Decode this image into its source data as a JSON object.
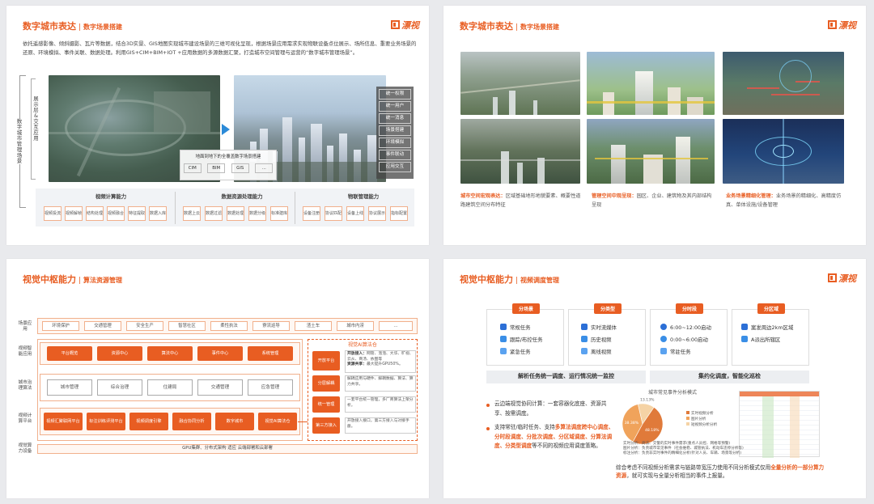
{
  "brand": {
    "logo": "漂视",
    "accent": "#e85d22"
  },
  "s1": {
    "title": "数字城市表达",
    "sub": "数字场景搭建",
    "para": "依托遥感影像、倾斜摄影、瓦片等数据，结合3D实景、GIS地图实现城市建设场景的三维可视化呈现，根据场景应用需求实现物联设备点位展示、场所信息、重要业务场景的还原、环境模拟、事件关联、数据处理。利用GIS+CIM+BIM+IOT +应用数据的多源数据汇聚，打造城市空间管理与运营的“数字城市管理场景”。",
    "side_outer": "数字城市管理场景",
    "side_inner": "展示层&交互应用",
    "menu": [
      "统一权限",
      "统一用户",
      "统一消息",
      "场景搭建",
      "环境模拟",
      "事件联动",
      "应用交互"
    ],
    "ground_title": "地面到地下的全覆盖数字场景搭建",
    "ground_items": [
      "CIM",
      "BIM",
      "GIS",
      "..."
    ],
    "groups": [
      {
        "title": "视频计算能力",
        "items": [
          "视频投流",
          "视频解帧",
          "结构处理",
          "视频融合",
          "特征提取",
          "数据入库"
        ]
      },
      {
        "title": "数据资源处理能力",
        "items": [
          "数据上云",
          "数据过滤",
          "数据处理",
          "数据分级",
          "标准建库"
        ]
      },
      {
        "title": "物联管理能力",
        "items": [
          "设备注册",
          "协议匹配",
          "设备上线",
          "协议展示",
          "指标配置"
        ]
      }
    ]
  },
  "s2": {
    "title": "数字城市表达",
    "sub": "数字场景搭建",
    "captions": [
      {
        "head": "城市空间宏观表达：",
        "body": "区域基础地形地貌要素、概要性道路建筑空间分布特征"
      },
      {
        "head": "管理空间中观呈现：",
        "body": "园区、企业、建筑物及其内部结构呈现"
      },
      {
        "head": "业务场景精细化管理：",
        "body": "业务场景的精细化、高精度仿真、单体设施/设备管理"
      }
    ]
  },
  "s3": {
    "title": "视觉中枢能力",
    "sub": "算法资源管理",
    "rows": [
      {
        "label": "场景应用",
        "items": [
          "环境保护",
          "交通管理",
          "安全生产",
          "智慧社区",
          "柔性执法",
          "寮流巡导",
          "渣土车",
          "城市内涝",
          "..."
        ]
      },
      {
        "label": "视频智能应用",
        "items": [
          "平台概览",
          "资源中心",
          "算法中心",
          "事件中心",
          "系统管理"
        ]
      },
      {
        "label": "城市治理算法",
        "items": [
          "城市管理",
          "综合治理",
          "住建局",
          "交通管理",
          "应急管理"
        ]
      },
      {
        "label": "视频计算平台",
        "items": [
          "视频汇聚联网平台",
          "标注训练评测平台",
          "视频调度引擎",
          "融合协同分析",
          "数字城市",
          "视觉AI算法仓"
        ]
      },
      {
        "label": "视觉算力设备",
        "items": [
          "GPU集群、分布式架构 适应 云端部署和云部署"
        ]
      }
    ],
    "ai_title": "视觉AI算法仓",
    "ai_items": [
      {
        "name": "开放平台",
        "head": "开放接入：",
        "text": "网管、泡泡、大华、旷视、云从、商汤、依图等",
        "head2": "资源共享：",
        "text2": "最大提升GPU50%。"
      },
      {
        "name": "分层解耦",
        "text": "解耦应用与硬件、解耦数据、算法、算力共享。"
      },
      {
        "name": "统一管理",
        "text": "一套平台统一管理，多厂商算法上架分析。"
      },
      {
        "name": "第三方接入",
        "text": "开放接入接口，第三方接入与对接手册。"
      }
    ]
  },
  "s4": {
    "title": "视觉中枢能力",
    "sub": "视频调度管理",
    "cols": [
      {
        "tag": "分场景",
        "items": [
          "常规任务",
          "跟踪/布控任务",
          "紧急任务"
        ]
      },
      {
        "tag": "分类型",
        "items": [
          "实时流媒体",
          "历史视频",
          "离线视频"
        ]
      },
      {
        "tag": "分时段",
        "items": [
          "6:00~12:00启动",
          "0:00~6:00启动",
          "常驻任务"
        ]
      },
      {
        "tag": "分区域",
        "items": [
          "案发周边2km区域",
          "A派出所辖区"
        ]
      }
    ],
    "band_left": "解析任务统一调度、运行情况统一监控",
    "band_right": "集约化调度，智能化巡检",
    "b1": "云边端视觉协同计算：一套容器化底座、资源共享、按需调度。",
    "b2_a": "支持常驻/临时任务、支持",
    "b2_b": "多算法调度",
    "b2_c": "跨中心调度、分时段调度、分批次调度、分区域调度、分算法调度、分类型调度",
    "b2_d": "等不同的视频应用调度策略。",
    "chart_title": "城市常见事件分析模式",
    "notes": [
      "实时分析：商法、交警的实时事件需求(重点人员控、网格等预警)",
      "图片分析：负责城市常见事件（社会维稳、城管执法、机动车违停分析等)",
      "标注分析：负责非实时事件的精细化分析(针对人员、车辆、场景等分析)"
    ],
    "summary_a": "综合考虑不同视频分析需求与链路带宽压力使用不同分析模式仅用",
    "summary_b": "全量分析的一部分算力资源",
    "summary_c": "，就可实现与全量分析相当的事件上报量。"
  },
  "chart_data": {
    "type": "pie",
    "title": "城市常见事件分析模式",
    "values": [
      48.18,
      38.38,
      13.13
    ],
    "labels": [
      "48.18%",
      "38.38%",
      "13.13%"
    ],
    "legend": [
      "实时视频分析",
      "图片分析",
      "短视频分析分析"
    ],
    "colors": [
      "#e07a3a",
      "#f0a35b",
      "#f5d3a5"
    ]
  }
}
